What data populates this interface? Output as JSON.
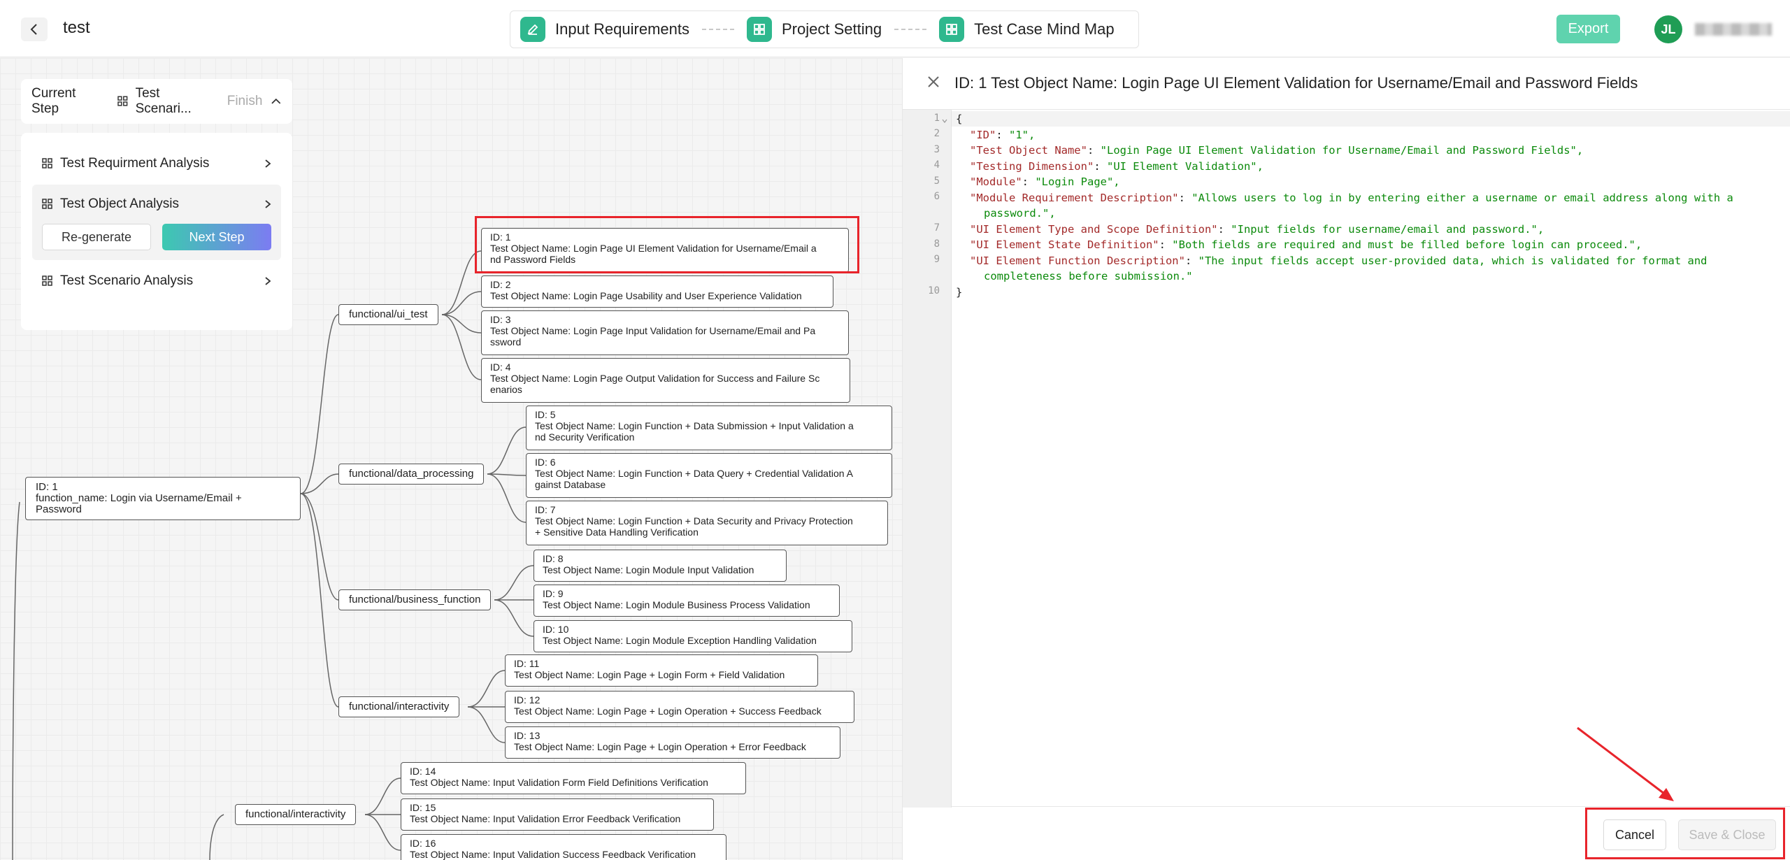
{
  "header": {
    "title": "test",
    "steps": [
      "Input Requirements",
      "Project Setting",
      "Test Case Mind Map"
    ],
    "export_label": "Export",
    "avatar_initials": "JL"
  },
  "sidebar": {
    "current_step_label": "Current Step",
    "current_step_value": "Test Scenari...",
    "finish_label": "Finish",
    "items": [
      {
        "label": "Test Requirment Analysis"
      },
      {
        "label": "Test Object Analysis"
      },
      {
        "label": "Test Scenario Analysis"
      }
    ],
    "regenerate_label": "Re-generate",
    "next_step_label": "Next Step"
  },
  "mindmap": {
    "root": {
      "id": "ID: 1",
      "name": "function_name: Login via Username/Email + Password"
    },
    "categories": [
      "functional/ui_test",
      "functional/data_processing",
      "functional/business_function",
      "functional/interactivity",
      "functional/interactivity"
    ],
    "nodes": [
      {
        "id": "ID: 1",
        "name": "Test Object Name: Login Page UI Element Validation for Username/Email a",
        "name2": "nd Password Fields"
      },
      {
        "id": "ID: 2",
        "name": "Test Object Name: Login Page Usability and User Experience Validation",
        "name2": ""
      },
      {
        "id": "ID: 3",
        "name": "Test Object Name: Login Page Input Validation for Username/Email and Pa",
        "name2": "ssword"
      },
      {
        "id": "ID: 4",
        "name": "Test Object Name: Login Page Output Validation for Success and Failure Sc",
        "name2": "enarios"
      },
      {
        "id": "ID: 5",
        "name": "Test Object Name: Login Function + Data Submission + Input Validation a",
        "name2": "nd Security Verification"
      },
      {
        "id": "ID: 6",
        "name": "Test Object Name: Login Function + Data Query + Credential Validation A",
        "name2": "gainst Database"
      },
      {
        "id": "ID: 7",
        "name": "Test Object Name: Login Function + Data Security and Privacy Protection",
        "name2": "+ Sensitive Data Handling Verification"
      },
      {
        "id": "ID: 8",
        "name": "Test Object Name: Login Module Input Validation",
        "name2": ""
      },
      {
        "id": "ID: 9",
        "name": "Test Object Name: Login Module Business Process Validation",
        "name2": ""
      },
      {
        "id": "ID: 10",
        "name": "Test Object Name: Login Module Exception Handling Validation",
        "name2": ""
      },
      {
        "id": "ID: 11",
        "name": "Test Object Name: Login Page + Login Form + Field Validation",
        "name2": ""
      },
      {
        "id": "ID: 12",
        "name": "Test Object Name: Login Page + Login Operation + Success Feedback",
        "name2": ""
      },
      {
        "id": "ID: 13",
        "name": "Test Object Name: Login Page + Login Operation + Error Feedback",
        "name2": ""
      },
      {
        "id": "ID: 14",
        "name": "Test Object Name: Input Validation Form Field Definitions Verification",
        "name2": ""
      },
      {
        "id": "ID: 15",
        "name": "Test Object Name: Input Validation Error Feedback Verification",
        "name2": ""
      },
      {
        "id": "ID: 16",
        "name": "Test Object Name: Input Validation Success Feedback Verification",
        "name2": ""
      }
    ]
  },
  "panel": {
    "title": "ID: 1 Test Object Name: Login Page UI Element Validation for Username/Email and Password Fields",
    "line_numbers": [
      "1",
      "2",
      "3",
      "4",
      "5",
      "6",
      "7",
      "8",
      "9",
      "10"
    ],
    "code": {
      "open": "{",
      "close": "}",
      "entries": [
        {
          "key": "\"ID\"",
          "value": "\"1\","
        },
        {
          "key": "\"Test Object Name\"",
          "value": "\"Login Page UI Element Validation for Username/Email and Password Fields\","
        },
        {
          "key": "\"Testing Dimension\"",
          "value": "\"UI Element Validation\","
        },
        {
          "key": "\"Module\"",
          "value": "\"Login Page\","
        },
        {
          "key": "\"Module Requirement Description\"",
          "value": "\"Allows users to log in by entering either a username or email address along with a",
          "cont": "password.\","
        },
        {
          "key": "\"UI Element Type and Scope Definition\"",
          "value": "\"Input fields for username/email and password.\","
        },
        {
          "key": "\"UI Element State Definition\"",
          "value": "\"Both fields are required and must be filled before login can proceed.\","
        },
        {
          "key": "\"UI Element Function Description\"",
          "value": "\"The input fields accept user-provided data, which is validated for format and",
          "cont": "completeness before submission.\""
        }
      ]
    },
    "cancel_label": "Cancel",
    "save_label": "Save & Close"
  },
  "colors": {
    "accent_green": "#2fb88e",
    "export_bg": "#5fd3ae",
    "highlight_red": "#e8242b",
    "json_key": "#a32a2a",
    "json_string": "#0b8a0b"
  }
}
